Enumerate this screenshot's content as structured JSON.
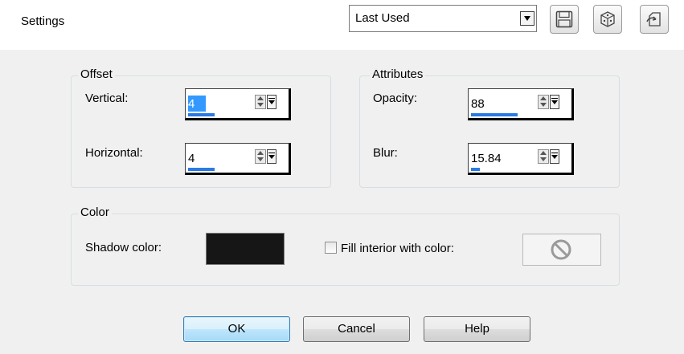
{
  "header": {
    "settings_label": "Settings",
    "preset": {
      "selected": "Last Used"
    },
    "tools": [
      {
        "icon": "floppy-disk-icon"
      },
      {
        "icon": "dice-icon"
      },
      {
        "icon": "reset-preset-icon"
      }
    ]
  },
  "offset": {
    "title": "Offset",
    "vertical_label": "Vertical:",
    "vertical_value": "4",
    "vertical_fill": 0.5,
    "horizontal_label": "Horizontal:",
    "horizontal_value": "4",
    "horizontal_fill": 0.5
  },
  "attributes": {
    "title": "Attributes",
    "opacity_label": "Opacity:",
    "opacity_value": "88",
    "opacity_fill": 0.88,
    "blur_label": "Blur:",
    "blur_value": "15.84",
    "blur_fill": 0.16
  },
  "color": {
    "title": "Color",
    "shadow_label": "Shadow color:",
    "shadow_color": "#161616",
    "fill_checkbox_label": "Fill interior with color:",
    "fill_checked": false,
    "fill_icon": "no-color-icon"
  },
  "buttons": {
    "ok": "OK",
    "cancel": "Cancel",
    "help": "Help"
  }
}
